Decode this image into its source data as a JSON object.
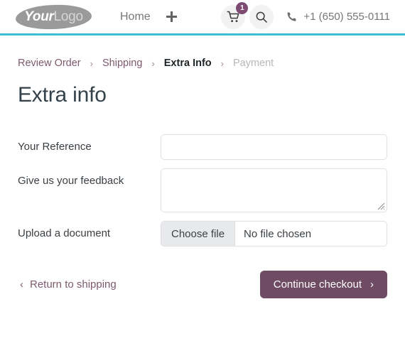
{
  "header": {
    "logo": {
      "icon": "logo-blob-icon",
      "text_bold": "Your",
      "text_light": "Logo"
    },
    "nav": {
      "home_label": "Home",
      "add_icon": "plus-icon"
    },
    "cart": {
      "icon": "shopping-cart-icon",
      "badge_count": "1"
    },
    "search": {
      "icon": "search-icon"
    },
    "phone": {
      "icon": "phone-icon",
      "number": "+1 (650) 555-0111"
    },
    "accent_color": "#3bbfd9"
  },
  "breadcrumb": {
    "separator": "›",
    "items": [
      {
        "label": "Review Order",
        "state": "link"
      },
      {
        "label": "Shipping",
        "state": "link"
      },
      {
        "label": "Extra Info",
        "state": "current"
      },
      {
        "label": "Payment",
        "state": "disabled"
      }
    ]
  },
  "page": {
    "title": "Extra info"
  },
  "form": {
    "reference": {
      "label": "Your Reference",
      "value": "",
      "placeholder": ""
    },
    "feedback": {
      "label": "Give us your feedback",
      "value": "",
      "placeholder": ""
    },
    "upload": {
      "label": "Upload a document",
      "button_label": "Choose file",
      "file_status": "No file chosen"
    }
  },
  "actions": {
    "back": {
      "label": "Return to shipping",
      "icon": "chevron-left-icon"
    },
    "continue": {
      "label": "Continue checkout",
      "icon": "chevron-right-icon",
      "color": "#6f4c63"
    }
  }
}
